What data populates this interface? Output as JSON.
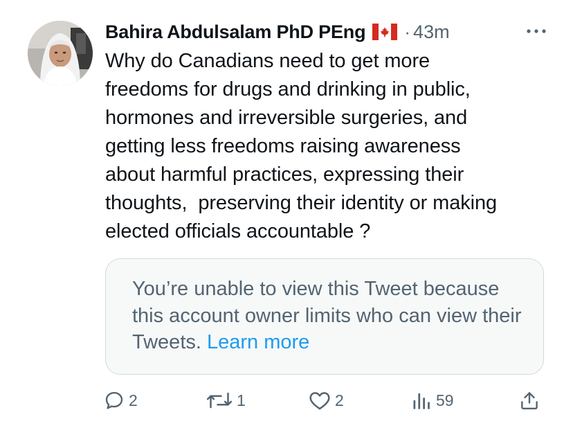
{
  "author": {
    "display_name": "Bahira Abdulsalam PhD PEng",
    "flag": "canada-flag",
    "separator": "·",
    "timestamp": "43m",
    "more_icon": "more-horizontal-icon"
  },
  "tweet": {
    "text": "Why do Canadians need to get more\nfreedoms for drugs and drinking in public,\nhormones and irreversible surgeries, and\ngetting less freedoms raising awareness\nabout harmful practices, expressing their\nthoughts,  preserving their identity or making\nelected officials accountable ?"
  },
  "unavailable_card": {
    "message": "You’re unable to view this Tweet because this account owner limits who can view their Tweets.",
    "link": "Learn more"
  },
  "actions": {
    "reply": {
      "icon": "reply-icon",
      "count": "2"
    },
    "retweet": {
      "icon": "retweet-icon",
      "count": "1"
    },
    "like": {
      "icon": "heart-icon",
      "count": "2"
    },
    "views": {
      "icon": "views-icon",
      "count": "59"
    },
    "share": {
      "icon": "share-icon"
    }
  },
  "colors": {
    "text": "#0f1419",
    "secondary": "#536471",
    "link": "#1d9bf0",
    "card_background": "#f7f9f9",
    "card_border": "#cfd9de"
  }
}
